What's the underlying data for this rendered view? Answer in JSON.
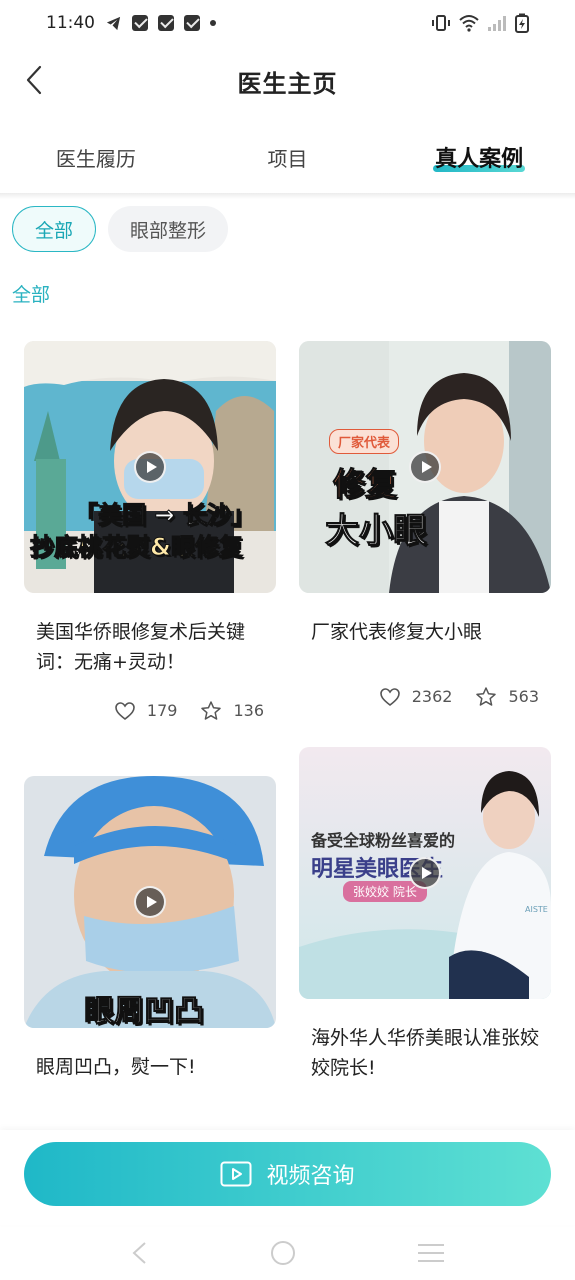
{
  "status_bar": {
    "time": "11:40",
    "icons": [
      "telegram-icon",
      "mail-icon",
      "mail-icon",
      "mail-icon",
      "dot-icon",
      "vibrate-icon",
      "wifi-icon",
      "signal-icon",
      "battery-charging-icon"
    ]
  },
  "header": {
    "title": "医生主页"
  },
  "tabs": [
    {
      "label": "医生履历",
      "active": false
    },
    {
      "label": "项目",
      "active": false
    },
    {
      "label": "真人案例",
      "active": true
    }
  ],
  "filters": [
    {
      "label": "全部",
      "active": true
    },
    {
      "label": "眼部整形",
      "active": false
    }
  ],
  "section_label": "全部",
  "cards": [
    {
      "title": "美国华侨眼修复术后关键词：无痛+灵动！",
      "likes": "179",
      "favorites": "136",
      "overlay": {
        "line1": "「美国 → 长沙」",
        "line2": "抄底桃花熨&眼修复"
      }
    },
    {
      "title": "厂家代表修复大小眼",
      "likes": "2362",
      "favorites": "563",
      "overlay": {
        "badge": "厂家代表",
        "line1": "修复",
        "line2": "大小眼"
      }
    },
    {
      "title": "眼周凹凸，熨一下!",
      "overlay": {
        "line1": "眼周凹凸"
      }
    },
    {
      "title": "海外华人华侨美眼认准张姣姣院长!",
      "overlay": {
        "line1": "备受全球粉丝喜爱的",
        "line2": "明星美眼医生",
        "line3": "张姣姣 院长",
        "brand": "AISTE"
      }
    }
  ],
  "bottom": {
    "consult_label": "视频咨询"
  },
  "colors": {
    "accent": "#2ab7c4",
    "accent_light": "#5ee0d3",
    "text": "#222222",
    "muted": "#555555"
  }
}
